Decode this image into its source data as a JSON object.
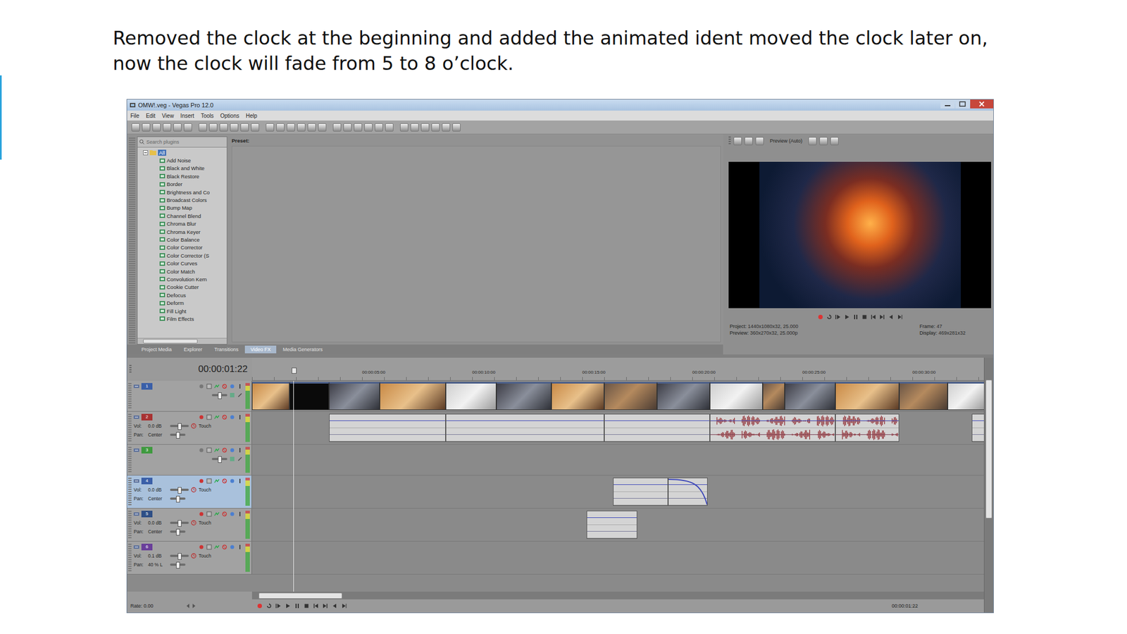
{
  "slide": {
    "caption": "Removed the clock at the beginning and added the animated ident moved the clock later on, now the clock will fade from 5 to 8 o’clock."
  },
  "window": {
    "title": "OMW!.veg - Vegas Pro 12.0"
  },
  "menu": [
    "File",
    "Edit",
    "View",
    "Insert",
    "Tools",
    "Options",
    "Help"
  ],
  "plugins": {
    "search_placeholder": "Search plugins",
    "root": {
      "label": "All",
      "expanded": true
    },
    "items": [
      "Add Noise",
      "Black and White",
      "Black Restore",
      "Border",
      "Brightness and Co",
      "Broadcast Colors",
      "Bump Map",
      "Channel Blend",
      "Chroma Blur",
      "Chroma Keyer",
      "Color Balance",
      "Color Corrector",
      "Color Corrector (S",
      "Color Curves",
      "Color Match",
      "Convolution Kern",
      "Cookie Cutter",
      "Defocus",
      "Deform",
      "Fill Light",
      "Film Effects"
    ]
  },
  "presets": {
    "label": "Preset:"
  },
  "dock_tabs": [
    {
      "label": "Project Media",
      "selected": false
    },
    {
      "label": "Explorer",
      "selected": false
    },
    {
      "label": "Transitions",
      "selected": false
    },
    {
      "label": "Video FX",
      "selected": true
    },
    {
      "label": "Media Generators",
      "selected": false
    }
  ],
  "preview": {
    "quality": "Preview (Auto)",
    "info": [
      {
        "label": "Project:",
        "value": "1440x1080x32, 25.000"
      },
      {
        "label": "Frame:",
        "value": "47"
      },
      {
        "label": "Preview:",
        "value": "360x270x32, 25.000p"
      },
      {
        "label": "Display:",
        "value": "469x281x32"
      }
    ]
  },
  "timeline": {
    "time": "00:00:01:22",
    "cursor_seconds": 1.88,
    "ruler": [
      {
        "label": "00:00:05:00",
        "seconds": 5
      },
      {
        "label": "00:00:10:00",
        "seconds": 10
      },
      {
        "label": "00:00:15:00",
        "seconds": 15
      },
      {
        "label": "00:00:20:00",
        "seconds": 20
      },
      {
        "label": "00:00:25:00",
        "seconds": 25
      },
      {
        "label": "00:00:30:00",
        "seconds": 30
      }
    ],
    "vol_label": "Vol:",
    "pan_label": "Pan:",
    "tracks": [
      {
        "number": "1",
        "kind": "video",
        "selected": false,
        "color": "#3a5fa8",
        "events": [
          {
            "start": 0,
            "end": 1.7
          },
          {
            "start": 1.7,
            "end": 3.5
          },
          {
            "start": 3.5,
            "end": 5.8
          },
          {
            "start": 5.8,
            "end": 8.8
          },
          {
            "start": 8.8,
            "end": 11.1
          },
          {
            "start": 11.1,
            "end": 13.6
          },
          {
            "start": 13.6,
            "end": 16.0
          },
          {
            "start": 16.0,
            "end": 18.4
          },
          {
            "start": 18.4,
            "end": 20.8
          },
          {
            "start": 20.8,
            "end": 23.2
          },
          {
            "start": 23.2,
            "end": 24.2
          },
          {
            "start": 24.2,
            "end": 26.5
          },
          {
            "start": 26.5,
            "end": 29.4
          },
          {
            "start": 29.4,
            "end": 31.6
          },
          {
            "start": 31.6,
            "end": 33.3
          }
        ]
      },
      {
        "number": "2",
        "kind": "audio",
        "selected": false,
        "color": "#a83232",
        "volume": "0.0 dB",
        "pan": "Center",
        "mode": "Touch",
        "events": [
          {
            "start": 3.5,
            "end": 8.8,
            "waveform": false,
            "fade_out": false
          },
          {
            "start": 8.8,
            "end": 16.0,
            "waveform": false,
            "fade_out": false
          },
          {
            "start": 16.0,
            "end": 20.8,
            "waveform": false,
            "fade_out": false
          },
          {
            "start": 20.8,
            "end": 26.5,
            "waveform": true,
            "fade_out": false
          },
          {
            "start": 26.5,
            "end": 29.4,
            "waveform": true,
            "fade_out": false
          },
          {
            "start": 32.7,
            "end": 33.3,
            "waveform": false,
            "fade_out": false
          }
        ]
      },
      {
        "number": "3",
        "kind": "video",
        "selected": false,
        "color": "#3f9a3f",
        "events": []
      },
      {
        "number": "4",
        "kind": "audio",
        "selected": true,
        "color": "#3a5fa8",
        "volume": "0.0 dB",
        "pan": "Center",
        "mode": "Touch",
        "events": [
          {
            "start": 16.4,
            "end": 18.9,
            "waveform": false,
            "fade_out": false
          },
          {
            "start": 18.9,
            "end": 20.7,
            "waveform": false,
            "fade_out": true
          }
        ]
      },
      {
        "number": "5",
        "kind": "audio",
        "selected": false,
        "color": "#2e4f86",
        "volume": "0.0 dB",
        "pan": "Center",
        "mode": "Touch",
        "events": [
          {
            "start": 15.2,
            "end": 17.5,
            "waveform": false,
            "fade_out": false
          }
        ]
      },
      {
        "number": "6",
        "kind": "audio",
        "selected": false,
        "color": "#6a3f9a",
        "volume": "0.1 dB",
        "pan": "40 % L",
        "mode": "Touch",
        "events": []
      }
    ],
    "rate": "Rate: 0.00",
    "status_time": "00:00:01:22"
  }
}
